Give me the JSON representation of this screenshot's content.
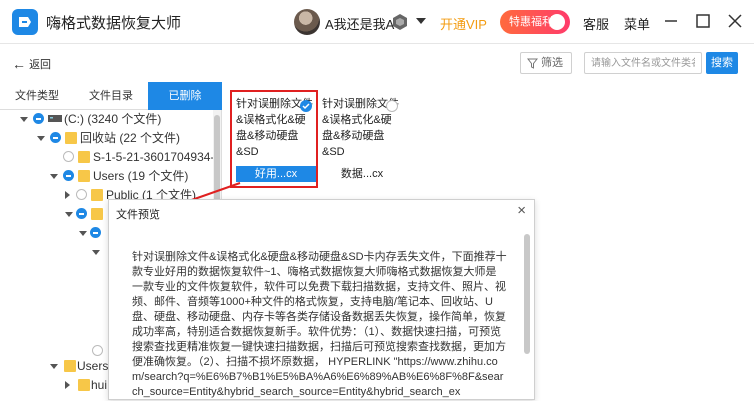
{
  "app": {
    "title": "嗨格式数据恢复大师",
    "username": "A我还是我A",
    "vip_label": "开通VIP",
    "promo_badge": "特惠福利",
    "service_label": "客服",
    "menu_label": "菜单",
    "accent_color": "#1e88e5",
    "vip_color": "#f39c12"
  },
  "toolbar": {
    "back_label": "返回",
    "filter_label": "筛选",
    "search_placeholder": "请输入文件名或文件类名",
    "search_button": "搜索"
  },
  "tabs": [
    {
      "label": "文件类型",
      "active": false
    },
    {
      "label": "文件目录",
      "active": false
    },
    {
      "label": "已删除",
      "active": true
    }
  ],
  "tree": [
    {
      "label": "(C:) (3240 个文件)",
      "icon": "drive-icon"
    },
    {
      "label": "回收站 (22 个文件)",
      "icon": "folder-icon"
    },
    {
      "label": "S-1-5-21-3601704934-",
      "icon": "folder-icon"
    },
    {
      "label": "Users (19 个文件)",
      "icon": "folder-icon"
    },
    {
      "label": "Public (1 个文件)",
      "icon": "folder-icon"
    },
    {
      "label": "Users",
      "icon": "folder-icon"
    },
    {
      "label": "hui",
      "icon": "folder-icon"
    }
  ],
  "cards": [
    {
      "text": "针对误删除文件&误格式化&硬盘&移动硬盘&SD",
      "name": "好用...cx",
      "selected": true
    },
    {
      "text": "针对误删除文件&误格式化&硬盘&移动硬盘&SD",
      "name": "数据...cx",
      "selected": false
    }
  ],
  "preview": {
    "title": "文件预览",
    "close": "×",
    "content": "针对误删除文件&误格式化&硬盘&移动硬盘&SD卡内存丢失文件，下面推荐十款专业好用的数据恢复软件~1、嗨格式数据恢复大师嗨格式数据恢复大师是一款专业的文件恢复软件，软件可以免费下载扫描数据，支持文件、照片、视频、邮件、音频等1000+种文件的格式恢复，支持电脑/笔记本、回收站、U盘、硬盘、移动硬盘、内存卡等各类存储设备数据丢失恢复，操作简单，恢复成功率高，特别适合数据恢复新手。软件优势：（1）、数据快速扫描，可预览搜索查找更精准恢复一键快速扫描数据，扫描后可预览搜索查找数据，更加方便准确恢复。（2）、扫描不损坏原数据，  HYPERLINK \"https://www.zhihu.com/search?q=%E6%B7%B1%E5%BA%A6%E6%89%AB%E6%8F%8F&search_source=Entity&hybrid_search_source=Entity&hybrid_search_ex"
  }
}
